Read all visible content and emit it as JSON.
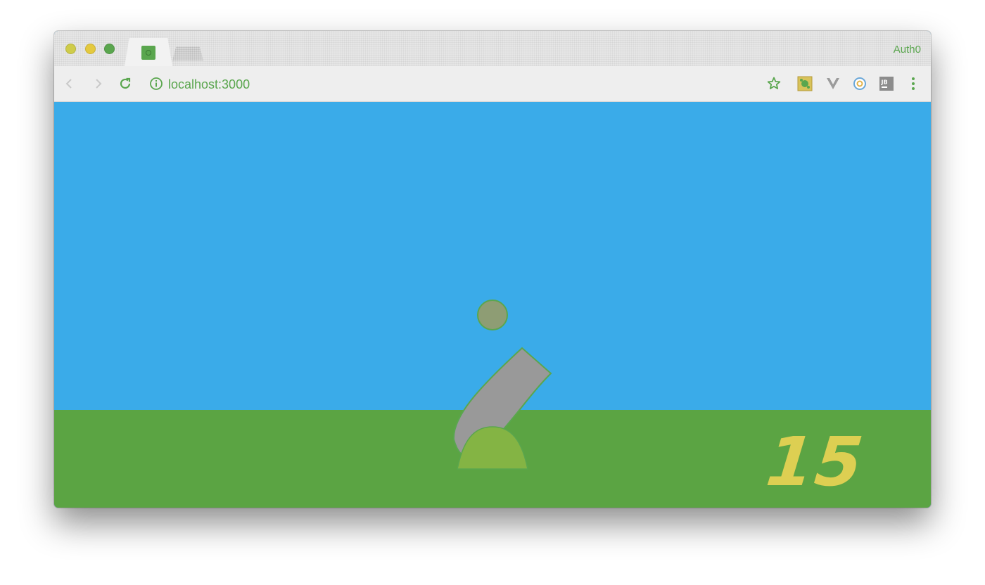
{
  "browser": {
    "tab": {
      "favicon": "game-favicon-icon"
    },
    "profile_label": "Auth0",
    "address_bar": {
      "url": "localhost:3000",
      "info_icon": "info-icon"
    },
    "toolbar_icons": [
      "back-icon",
      "forward-icon",
      "reload-icon",
      "star-icon",
      "extension-icon",
      "vue-devtools-icon",
      "extension-icon",
      "jetbrains-icon",
      "menu-icon"
    ]
  },
  "game": {
    "score": "15",
    "colors": {
      "sky": "#3aabe9",
      "ground": "#5ba443",
      "cannon_barrel": "#999999",
      "cannon_base": "#84b444",
      "cannon_ball": "#8e9d74",
      "score": "#ddcf52",
      "outline": "#5aa64e"
    }
  }
}
